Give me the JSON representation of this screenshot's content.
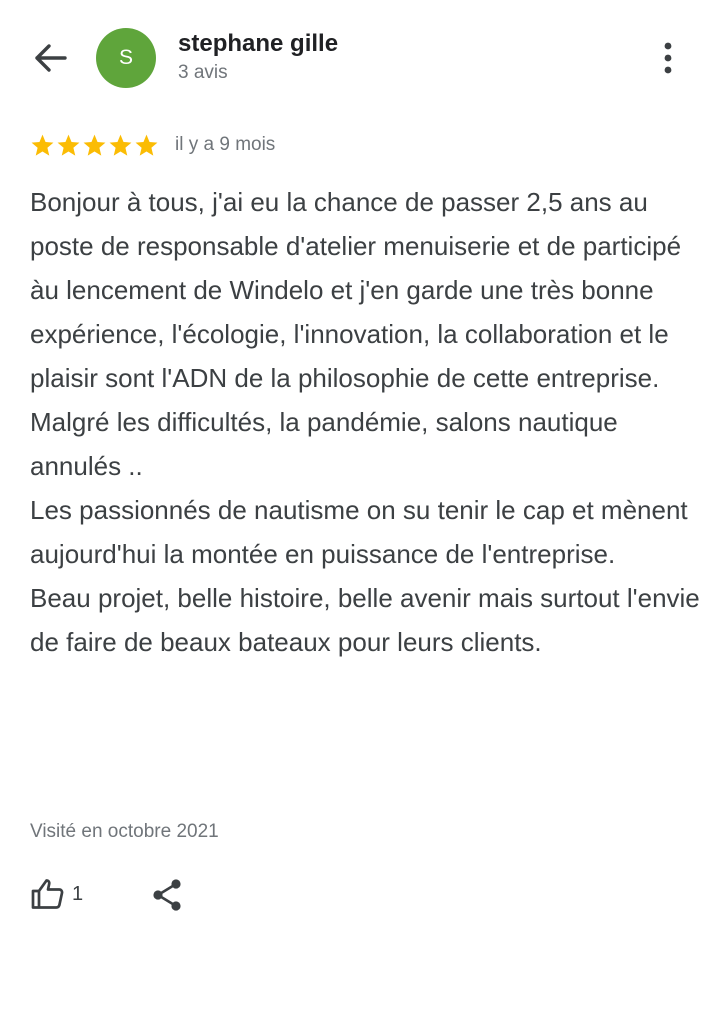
{
  "header": {
    "back_icon": "arrow-left-icon",
    "avatar_letter": "S",
    "avatar_color": "#5fa53b",
    "reviewer_name": "stephane gille",
    "review_count": "3 avis",
    "more_icon": "more-vert-icon"
  },
  "review": {
    "rating": 5,
    "rating_max": 5,
    "star_color": "#fbbc04",
    "date": "il y a 9 mois",
    "paragraphs": [
      "Bonjour à tous, j'ai eu la chance de passer 2,5 ans au poste de responsable d'atelier menuiserie et de participé àu lencement de Windelo et j'en garde une très bonne expérience, l'écologie, l'innovation, la collaboration et le plaisir sont l'ADN de la philosophie de cette entreprise. Malgré les difficultés, la pandémie, salons nautique annulés ..",
      "Les passionnés de nautisme on su tenir le cap et mènent aujourd'hui la montée en puissance de l'entreprise.",
      "Beau projet, belle histoire, belle avenir mais surtout l'envie de faire de beaux bateaux pour leurs clients."
    ],
    "visit": "Visité en octobre 2021"
  },
  "actions": {
    "like_icon": "thumb-up-icon",
    "like_count": "1",
    "share_icon": "share-icon"
  }
}
